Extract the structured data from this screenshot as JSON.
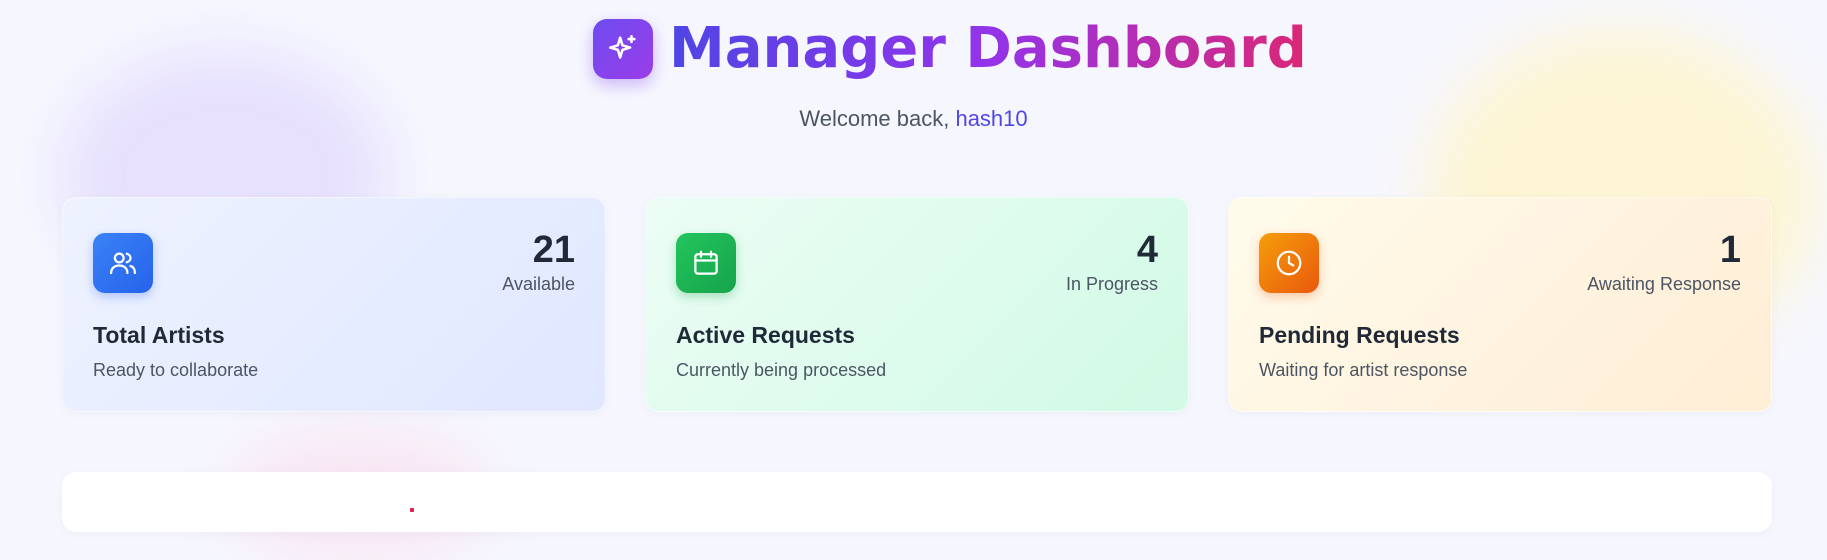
{
  "header": {
    "title": "Manager Dashboard",
    "welcome_prefix": "Welcome back,",
    "username": "hash10",
    "logo_icon": "sparkles-icon"
  },
  "stats": [
    {
      "icon": "users-icon",
      "accent": "#2563eb",
      "value": "21",
      "label": "Available",
      "title": "Total Artists",
      "subtitle": "Ready to collaborate"
    },
    {
      "icon": "calendar-icon",
      "accent": "#16a34a",
      "value": "4",
      "label": "In Progress",
      "title": "Active Requests",
      "subtitle": "Currently being processed"
    },
    {
      "icon": "clock-icon",
      "accent": "#ea580c",
      "value": "1",
      "label": "Awaiting Response",
      "title": "Pending Requests",
      "subtitle": "Waiting for artist response"
    }
  ],
  "colors": {
    "title_gradient": [
      "#4f46e5",
      "#9333ea",
      "#db2777"
    ],
    "username": "#4f46e5"
  }
}
